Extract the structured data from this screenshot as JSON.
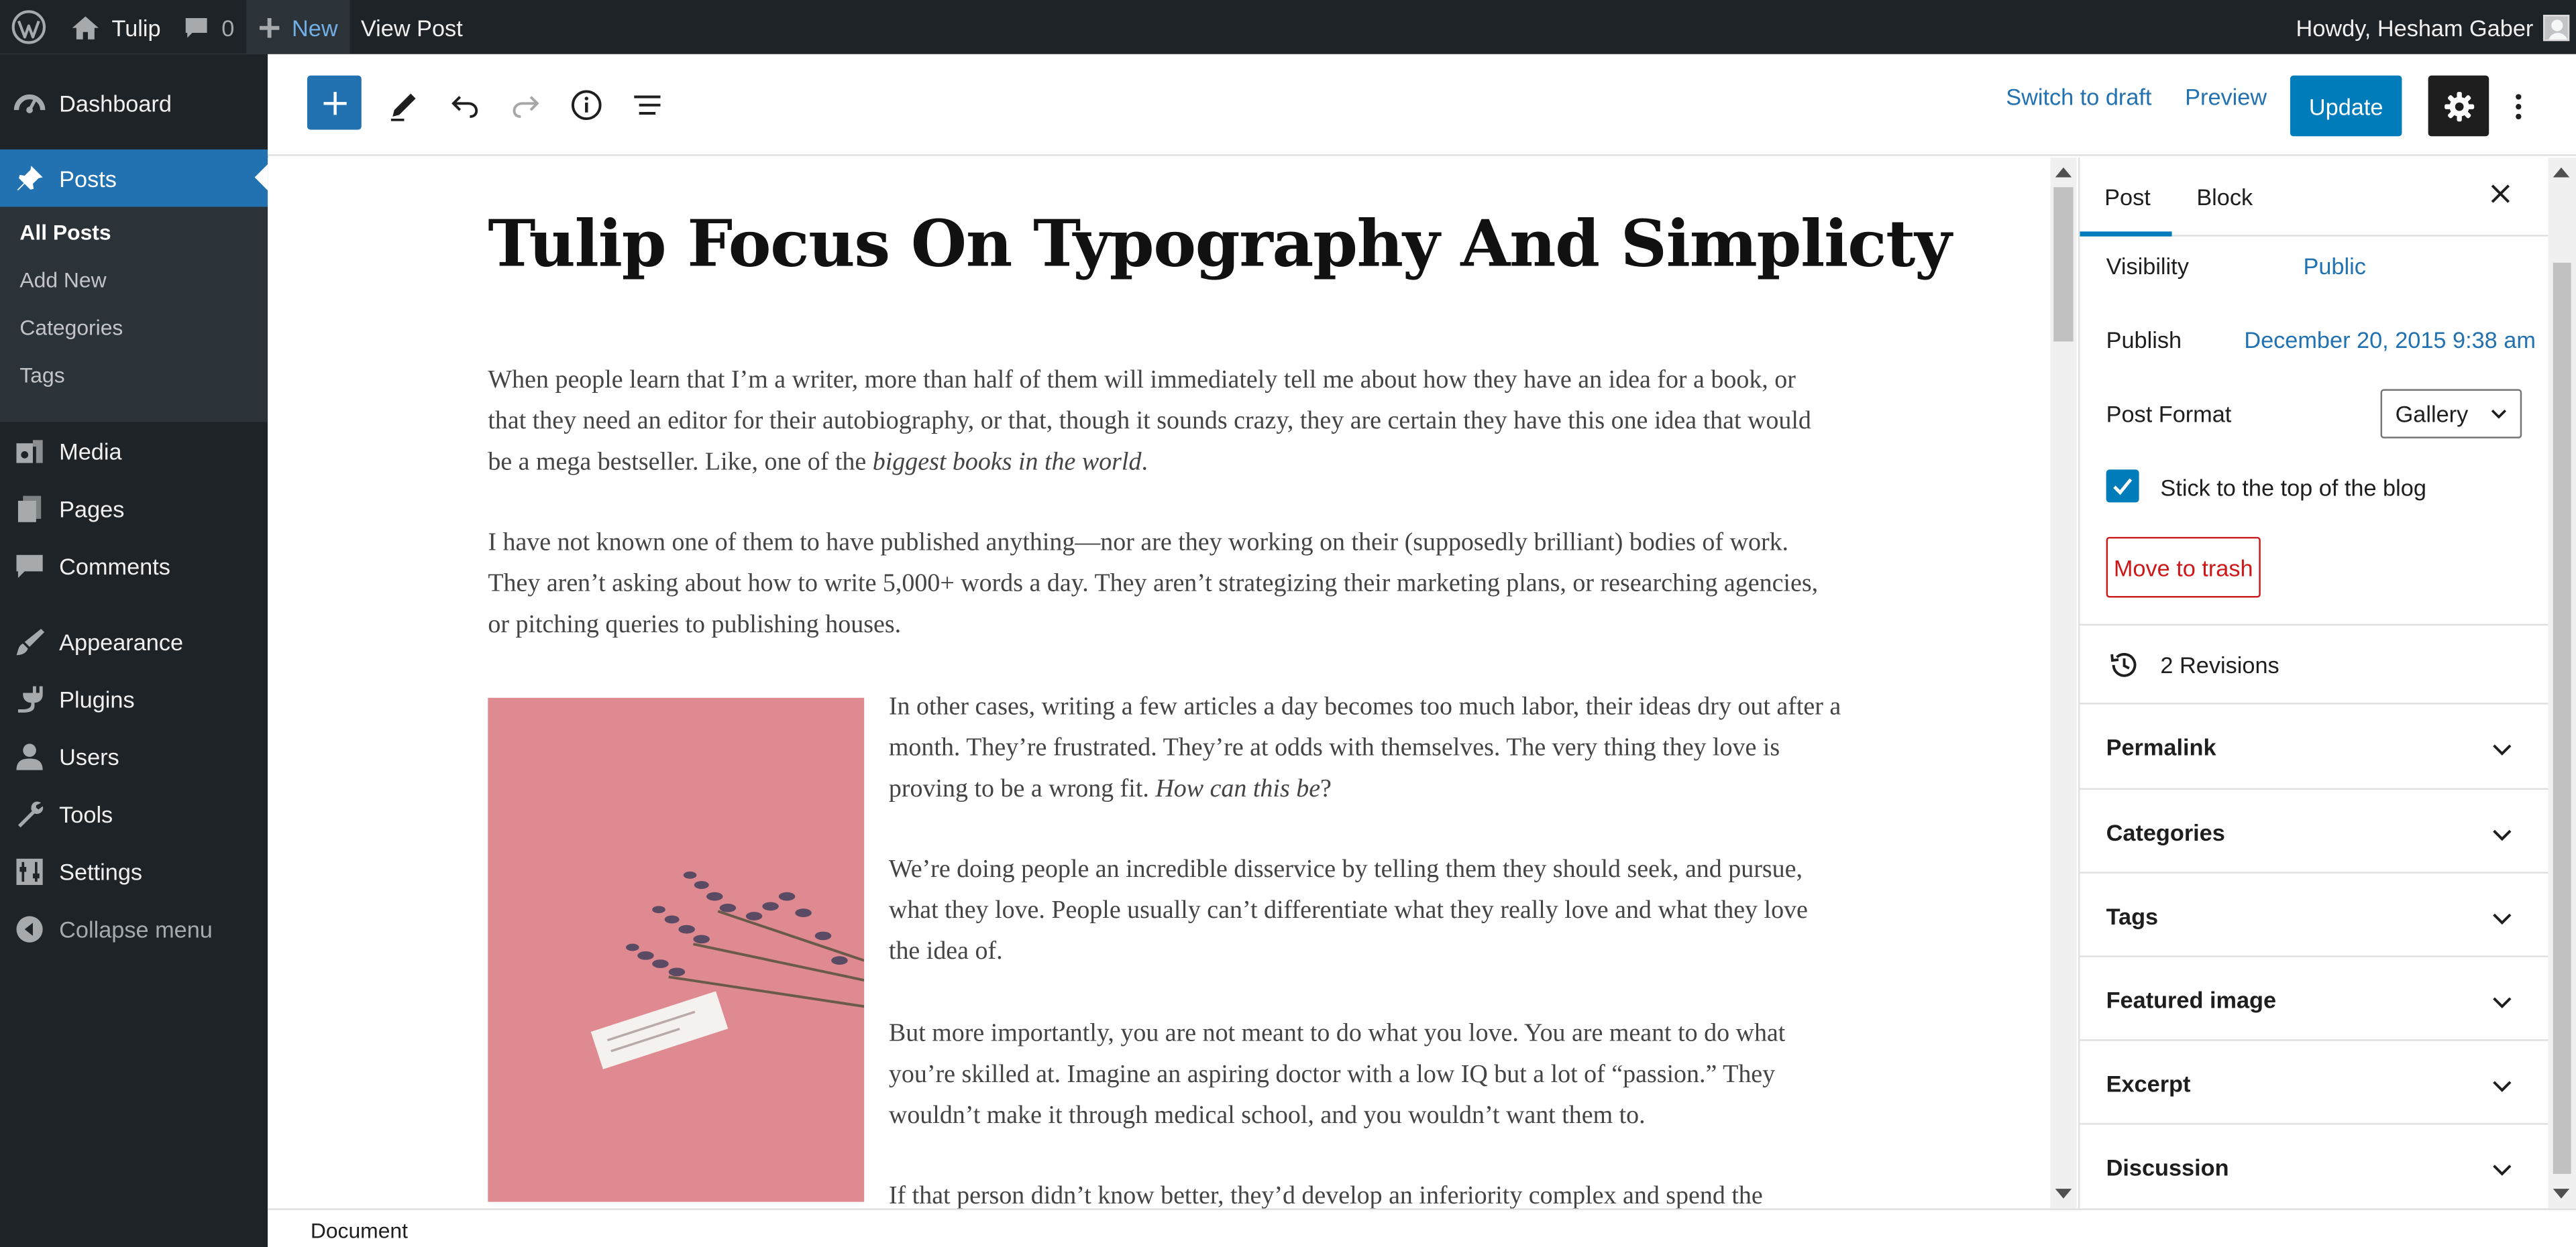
{
  "admin_bar": {
    "site_name": "Tulip",
    "comments_count": "0",
    "new_label": "New",
    "view_post_label": "View Post",
    "greeting": "Howdy, Hesham Gaber"
  },
  "admin_menu": {
    "items": [
      {
        "label": "Dashboard",
        "icon": "dashboard-icon"
      },
      {
        "label": "Posts",
        "icon": "pin-icon",
        "current": true
      },
      {
        "label": "Media",
        "icon": "media-icon"
      },
      {
        "label": "Pages",
        "icon": "pages-icon"
      },
      {
        "label": "Comments",
        "icon": "comment-icon"
      },
      {
        "label": "Appearance",
        "icon": "brush-icon"
      },
      {
        "label": "Plugins",
        "icon": "plug-icon"
      },
      {
        "label": "Users",
        "icon": "user-icon"
      },
      {
        "label": "Tools",
        "icon": "wrench-icon"
      },
      {
        "label": "Settings",
        "icon": "settings-sliders-icon"
      }
    ],
    "submenu": [
      "All Posts",
      "Add New",
      "Categories",
      "Tags"
    ],
    "collapse_label": "Collapse menu"
  },
  "toolbar": {
    "switch_to_draft": "Switch to draft",
    "preview": "Preview",
    "update": "Update"
  },
  "post": {
    "title": "Tulip Focus On Typography And Simplicty",
    "p1": "When people learn that I’m a writer, more than half of them will immediately tell me about how they have an idea for a book, or that they need an editor for their autobiography, or that, though it sounds crazy, they are certain they have this one idea that would be a mega bestseller. Like, one of the ",
    "p1_em": "biggest books in the world",
    "p1_end": ".",
    "p2": "I have not known one of them to have published anything—nor are they working on their (supposedly brilliant) bodies of work. They aren’t asking about how to write 5,000+ words a day. They aren’t strategizing their marketing plans, or researching agencies, or pitching queries to publishing houses.",
    "p3": "In other cases, writing a few articles a day becomes too much labor, their ideas dry out after a month. They’re frustrated. They’re at odds with themselves. The very thing they love is proving to be a wrong fit. ",
    "p3_em": "How can this be",
    "p3_end": "?",
    "p4": "We’re doing people an incredible disservice by telling them they should seek, and pursue, what they love. People usually can’t differentiate what they really love and what they love the idea of.",
    "p5": "But more importantly, you are not meant to do what you love. You are meant to do what you’re skilled at. Imagine an aspiring doctor with a low IQ but a lot of “passion.” They wouldn’t make it through medical school, and you wouldn’t want them to.",
    "p6": "If that person didn’t know better, they’d develop an inferiority complex and spend the"
  },
  "sidebar": {
    "tab_post": "Post",
    "tab_block": "Block",
    "visibility_label": "Visibility",
    "visibility_value": "Public",
    "publish_label": "Publish",
    "publish_value": "December 20, 2015 9:38 am",
    "format_label": "Post Format",
    "format_value": "Gallery",
    "sticky_label": "Stick to the top of the blog",
    "sticky_checked": true,
    "trash_label": "Move to trash",
    "revisions_label": "2 Revisions",
    "panels": [
      "Permalink",
      "Categories",
      "Tags",
      "Featured image",
      "Excerpt",
      "Discussion"
    ]
  },
  "footer": {
    "breadcrumb": "Document"
  },
  "colors": {
    "admin_dark": "#1d2327",
    "accent": "#2271b1",
    "button_primary": "#007cba",
    "danger": "#cc1818"
  }
}
